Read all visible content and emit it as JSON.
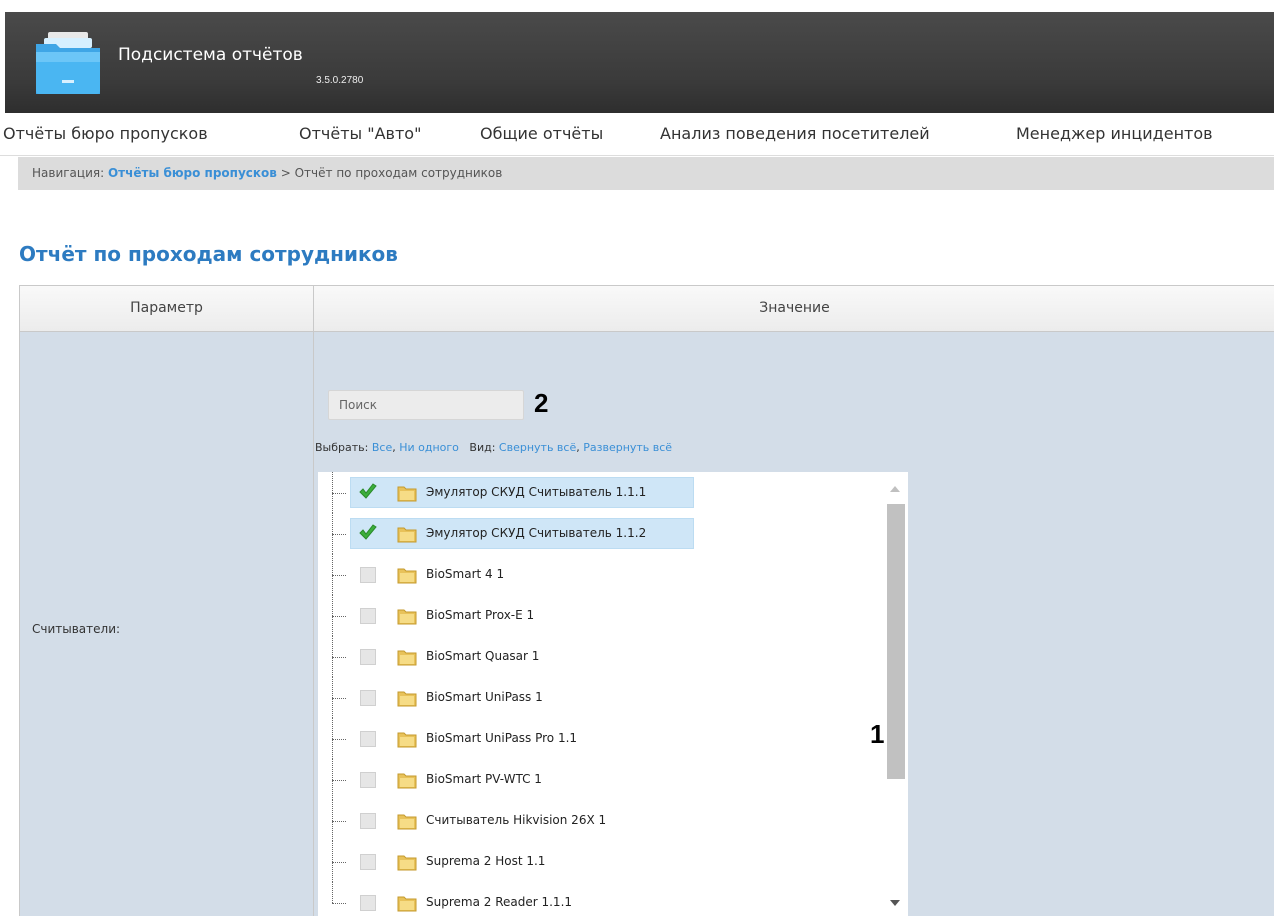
{
  "app": {
    "title": "Подсистема отчётов",
    "version": "3.5.0.2780"
  },
  "menu": [
    {
      "label": "Отчёты бюро пропусков"
    },
    {
      "label": "Отчёты \"Авто\""
    },
    {
      "label": "Общие отчёты"
    },
    {
      "label": "Анализ поведения посетителей"
    },
    {
      "label": "Менеджер инцидентов"
    }
  ],
  "breadcrumb": {
    "prefix": "Навигация:",
    "link": "Отчёты бюро пропусков",
    "separator": ">",
    "current": "Отчёт по проходам сотрудников"
  },
  "page_title": "Отчёт по проходам сотрудников",
  "table": {
    "col_param": "Параметр",
    "col_value": "Значение",
    "row_label": "Считыватели:"
  },
  "search": {
    "placeholder": "Поиск"
  },
  "select_bar": {
    "select_label": "Выбрать:",
    "all": "Все",
    "comma": ",",
    "none": "Ни одного",
    "view_label": "Вид:",
    "collapse": "Свернуть всё",
    "expand": "Развернуть всё"
  },
  "tree_items": [
    {
      "label": "Эмулятор СКУД Считыватель 1.1.1",
      "checked": true
    },
    {
      "label": "Эмулятор СКУД Считыватель 1.1.2",
      "checked": true
    },
    {
      "label": "BioSmart 4 1",
      "checked": false
    },
    {
      "label": "BioSmart Prox-E 1",
      "checked": false
    },
    {
      "label": "BioSmart Quasar 1",
      "checked": false
    },
    {
      "label": "BioSmart UniPass 1",
      "checked": false
    },
    {
      "label": "BioSmart UniPass Pro 1.1",
      "checked": false
    },
    {
      "label": "BioSmart PV-WTC 1",
      "checked": false
    },
    {
      "label": "Считыватель Hikvision 26X 1",
      "checked": false
    },
    {
      "label": "Suprema 2 Host 1.1",
      "checked": false
    },
    {
      "label": "Suprema 2 Reader 1.1.1",
      "checked": false
    }
  ],
  "callouts": {
    "search": "2",
    "list": "1"
  },
  "colors": {
    "accent": "#2d7bc1",
    "link": "#3a8fd6",
    "cell_bg": "#d3dde8",
    "selected_row": "#cfe6f7",
    "check_green": "#3cae3c"
  },
  "icons": {
    "logo": "folder-app-icon",
    "check": "green-check-icon",
    "folder": "folder-icon"
  }
}
